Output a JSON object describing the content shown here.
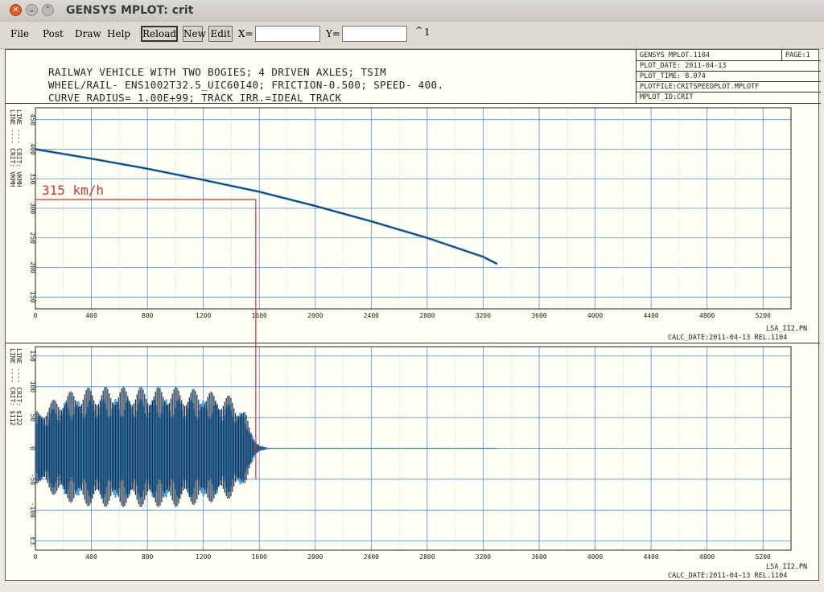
{
  "window": {
    "title": "GENSYS MPLOT: crit"
  },
  "menu": {
    "file": "File",
    "post": "Post",
    "draw": "Draw",
    "help": "Help"
  },
  "toolbar": {
    "reload": "Reload",
    "new": "New",
    "edit": "Edit",
    "x_label": "X=",
    "y_label": "Y=",
    "x_value": "",
    "y_value": "",
    "page_indicator": "1"
  },
  "header": {
    "line1": "RAILWAY VEHICLE WITH TWO BOGIES; 4 DRIVEN AXLES; TSIM",
    "line2": "WHEEL/RAIL- ENS1002T32.5_UIC60I40; FRICTION-0.500; SPEED- 400.",
    "line3": "CURVE RADIUS= 1.00E+99; TRACK IRR.=IDEAL_TRACK"
  },
  "info": {
    "program": "GENSYS MPLOT.1104",
    "page": "PAGE:1",
    "plot_date": "PLOT_DATE: 2011-04-13",
    "plot_time": "PLOT_TIME:  8.074",
    "plotfile": "PLOTFILE:CRITSPEEDPLOT.MPLOTF",
    "mplot_id": "MPLOT_ID:CRIT"
  },
  "footer": {
    "top_file": "LSA_II2.PN",
    "top_calc": "CALC_DATE:2011-04-13 REL.1104",
    "bottom_file": "LSA_II2.PN",
    "bottom_calc": "CALC_DATE:2011-04-13 REL.1104"
  },
  "annotation": {
    "label": "315 km/h",
    "color": "#e03030"
  },
  "colors": {
    "grid": "#4a90d9",
    "line_dark": "#102a4a",
    "line_light": "#4aa3e0",
    "marker": "#e03030"
  },
  "chart_data": [
    {
      "type": "line",
      "legend": [
        "LINE ---- CRIT: VKMH",
        "LINE ---- CRIT: VKMH"
      ],
      "x_ticks": [
        "0",
        "400",
        "800",
        "1200",
        "1600",
        "2000",
        "2400",
        "2800",
        "3200",
        "3600",
        "4000",
        "4400",
        "4800",
        "5200"
      ],
      "y_ticks": [
        "150",
        "200",
        "250",
        "300",
        "350",
        "400",
        "450"
      ],
      "xlim": [
        0,
        5400
      ],
      "ylim": [
        130,
        470
      ],
      "series": [
        {
          "name": "CRIT: VKMH",
          "x": [
            0,
            400,
            800,
            1200,
            1600,
            2000,
            2400,
            2800,
            3200,
            3300
          ],
          "y": [
            400,
            384,
            367,
            348,
            328,
            304,
            278,
            250,
            218,
            206
          ]
        }
      ],
      "marker": {
        "x": 1575,
        "y": 315
      }
    },
    {
      "type": "line",
      "legend": [
        "LINE ---- CRIT: $112",
        "LINE ---- CRIT: $122"
      ],
      "x_ticks": [
        "0",
        "400",
        "800",
        "1200",
        "1600",
        "2000",
        "2400",
        "2800",
        "3200",
        "3600",
        "4000",
        "4400",
        "4800",
        "5200"
      ],
      "y_ticks": [
        "E3",
        "-100",
        "-50",
        "0",
        "50",
        "100",
        "150"
      ],
      "xlim": [
        0,
        5400
      ],
      "ylim": [
        -165,
        165
      ],
      "series": [
        {
          "name": "CRIT: $112",
          "x": [
            0,
            200,
            400,
            600,
            800,
            1000,
            1200,
            1400,
            1500,
            1550,
            1600,
            1650,
            3300
          ],
          "y": [
            60,
            90,
            100,
            100,
            100,
            100,
            95,
            85,
            60,
            20,
            5,
            1,
            0
          ]
        },
        {
          "name": "CRIT: $122",
          "x": [
            0,
            200,
            400,
            600,
            800,
            1000,
            1200,
            1400,
            1500,
            1550,
            1600,
            1650,
            3300
          ],
          "y": [
            50,
            75,
            80,
            80,
            80,
            80,
            78,
            70,
            50,
            15,
            4,
            1,
            0
          ]
        }
      ],
      "marker_x": 1575
    }
  ]
}
